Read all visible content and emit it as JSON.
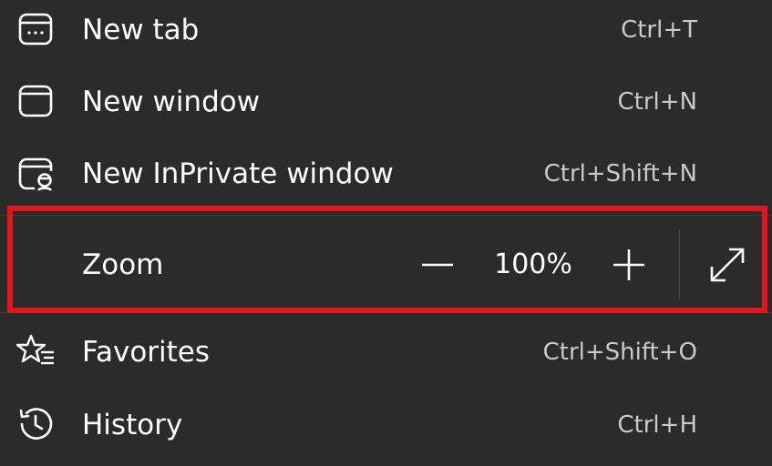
{
  "menu": {
    "items": [
      {
        "label": "New tab",
        "shortcut": "Ctrl+T",
        "icon": "new-tab-icon"
      },
      {
        "label": "New window",
        "shortcut": "Ctrl+N",
        "icon": "new-window-icon"
      },
      {
        "label": "New InPrivate window",
        "shortcut": "Ctrl+Shift+N",
        "icon": "inprivate-icon"
      }
    ],
    "zoom": {
      "label": "Zoom",
      "value": "100%",
      "decrease_icon": "minus-icon",
      "increase_icon": "plus-icon",
      "fullscreen_icon": "fullscreen-icon"
    },
    "items_after": [
      {
        "label": "Favorites",
        "shortcut": "Ctrl+Shift+O",
        "icon": "favorites-icon"
      },
      {
        "label": "History",
        "shortcut": "Ctrl+H",
        "icon": "history-icon"
      }
    ]
  },
  "colors": {
    "background": "#2b2b2b",
    "text": "#ffffff",
    "shortcut_text": "#c9c9c9",
    "highlight": "#e3141b"
  }
}
